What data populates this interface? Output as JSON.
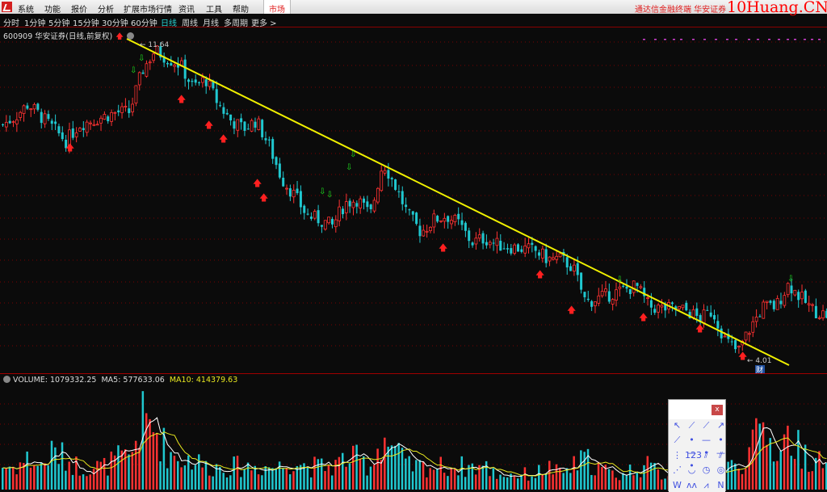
{
  "menubar": {
    "items": [
      "系统",
      "功能",
      "报价",
      "分析",
      "扩展市场行情",
      "资讯",
      "工具",
      "帮助"
    ],
    "market_tab": "市场",
    "brand": "通达信金融终端  华安证券",
    "watermark": "10Huang.CN"
  },
  "periods": {
    "items": [
      "分时",
      "1分钟",
      "5分钟",
      "15分钟",
      "30分钟",
      "60分钟",
      "日线",
      "周线",
      "月线",
      "多周期",
      "更多 >"
    ],
    "active": "日线"
  },
  "stock": {
    "code_name": "600909 华安证券(日线,前复权)",
    "high_label": "11.64",
    "low_label": "4.01",
    "badge": "财"
  },
  "volume": {
    "label": "VOLUME: 1079332.25",
    "ma5": "MA5: 577633.06",
    "ma10": "MA10: 414379.63"
  },
  "toolbox": {
    "close": "x",
    "tools": [
      "pointer-icon",
      "segment-icon",
      "line-icon",
      "ray-icon",
      "parallel-line-icon",
      "horizontal-segment-icon",
      "horizontal-line-icon",
      "horizontal-ray-icon",
      "vertical-line-icon",
      "price-label-icon",
      "parallel-channel-icon",
      "fibonacci-channel-icon",
      "dashed-line-icon",
      "arc-icon",
      "circle-icon",
      "circle-fan-icon",
      "w-pattern-icon",
      "wave-icon",
      "zigzag-icon",
      "n-pattern-icon"
    ]
  },
  "colors": {
    "up": "#ff3232",
    "down": "#20c8d0",
    "trendline": "#f0f000",
    "grid": "#7a0000",
    "ma5": "#ffffff",
    "ma10": "#e8e820"
  },
  "chart_data": {
    "type": "candlestick",
    "high": 11.64,
    "low": 4.01,
    "closes": [
      9.7,
      9.9,
      10.2,
      9.9,
      9.6,
      9.3,
      9.7,
      9.8,
      9.9,
      10.0,
      10.0,
      11.0,
      11.5,
      11.3,
      11.15,
      10.6,
      10.8,
      10.2,
      9.8,
      9.6,
      9.8,
      9.2,
      8.4,
      8.0,
      7.5,
      7.4,
      7.25,
      7.8,
      7.9,
      7.5,
      8.8,
      8.2,
      7.5,
      7.1,
      7.4,
      7.5,
      7.3,
      6.85,
      6.95,
      6.8,
      6.75,
      6.7,
      6.65,
      6.45,
      6.45,
      6.25,
      5.4,
      5.5,
      5.6,
      5.7,
      5.8,
      5.3,
      5.25,
      5.25,
      5.2,
      5.0,
      5.2,
      4.5,
      4.2,
      4.8,
      5.3,
      5.3,
      5.85,
      5.5,
      5.2,
      5.1
    ],
    "volumes": [
      3,
      3,
      4,
      3,
      5,
      4,
      3,
      3,
      3,
      4,
      4,
      9,
      8,
      5,
      4,
      4,
      3,
      3,
      3,
      3,
      3,
      3,
      3,
      4,
      3,
      3,
      3,
      4,
      4,
      3,
      7,
      5,
      3,
      3,
      3,
      3,
      3,
      3,
      3,
      2,
      2,
      2,
      2,
      3,
      2,
      3,
      4,
      3,
      2,
      2,
      3,
      3,
      2,
      2,
      2,
      2,
      2,
      3,
      3,
      5,
      8,
      5,
      7,
      5,
      4,
      3
    ]
  }
}
